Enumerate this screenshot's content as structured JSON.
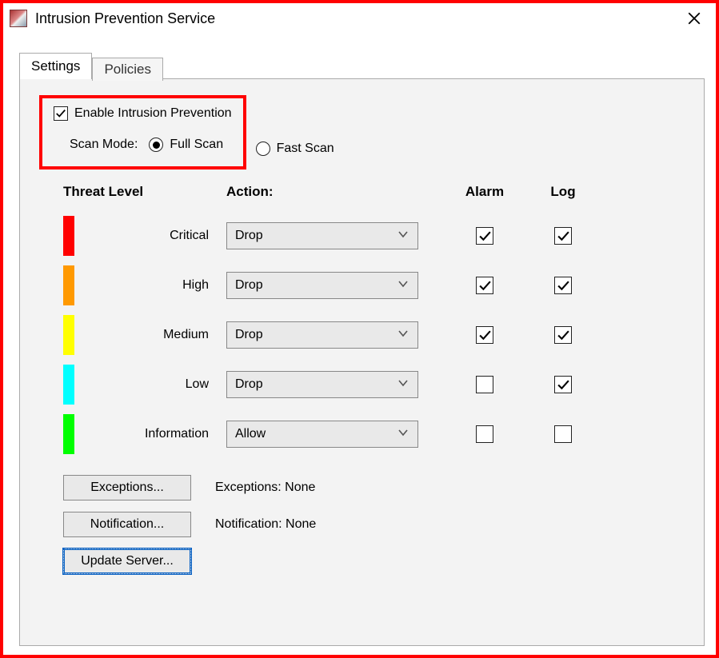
{
  "window": {
    "title": "Intrusion Prevention Service"
  },
  "tabs": {
    "settings": "Settings",
    "policies": "Policies",
    "active": "settings"
  },
  "enable": {
    "label": "Enable Intrusion Prevention",
    "checked": true
  },
  "scan_mode": {
    "label": "Scan Mode:",
    "options": {
      "full": "Full Scan",
      "fast": "Fast Scan"
    },
    "selected": "full"
  },
  "headers": {
    "threat": "Threat Level",
    "action": "Action:",
    "alarm": "Alarm",
    "log": "Log"
  },
  "levels": [
    {
      "name": "Critical",
      "color": "#ff0000",
      "action": "Drop",
      "alarm": true,
      "log": true
    },
    {
      "name": "High",
      "color": "#ff9900",
      "action": "Drop",
      "alarm": true,
      "log": true
    },
    {
      "name": "Medium",
      "color": "#ffff00",
      "action": "Drop",
      "alarm": true,
      "log": true
    },
    {
      "name": "Low",
      "color": "#00ffff",
      "action": "Drop",
      "alarm": false,
      "log": true
    },
    {
      "name": "Information",
      "color": "#00ff00",
      "action": "Allow",
      "alarm": false,
      "log": false
    }
  ],
  "buttons": {
    "exceptions": "Exceptions...",
    "notification": "Notification...",
    "update_server": "Update Server..."
  },
  "status": {
    "exceptions": "Exceptions: None",
    "notification": "Notification: None"
  }
}
